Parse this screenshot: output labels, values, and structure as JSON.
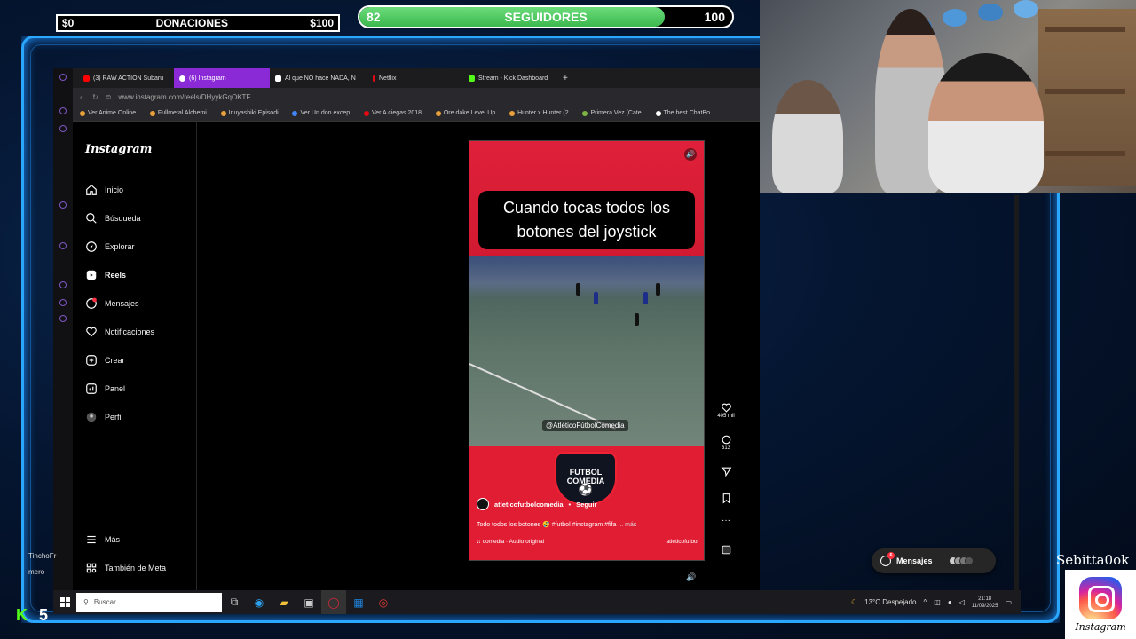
{
  "overlay": {
    "donation_min": "$0",
    "donation_title": "DONACIONES",
    "donation_max": "$100",
    "followers_current": "82",
    "followers_title": "SEGUIDORES",
    "followers_goal": "100",
    "followers_progress": 0.82,
    "streamer_name": "Sebitta0ok",
    "ig_word": "Instagram",
    "chat_user": "TinchoFr",
    "chat_text": "mero",
    "kick_letter": "K",
    "kick_count": "5"
  },
  "browser": {
    "tabs": [
      {
        "label": "(3) RAW ACTION Subaru",
        "color": "#ff0000"
      },
      {
        "label": "(6) Instagram",
        "color": "#ffffff",
        "active": true
      },
      {
        "label": "Al que NO hace NADA, N",
        "color": "#ffffff"
      },
      {
        "label": "Netflix",
        "color": "#e50914"
      },
      {
        "label": "Stream - Kick Dashboard",
        "color": "#53fc18"
      }
    ],
    "url": "www.instagram.com/reels/DHyykGqOKTF",
    "bookmarks": [
      "Ver Anime Online...",
      "Fullmetal Alchemi...",
      "Inuyashiki Episodi...",
      "Ver Un don excep...",
      "Ver A ciegas 2018...",
      "Ore dake Level Up...",
      "Hunter x Hunter (2...",
      "Primera Vez (Cate...",
      "The best ChatBo"
    ]
  },
  "instagram": {
    "logo": "Instagram",
    "nav": [
      {
        "label": "Inicio"
      },
      {
        "label": "Búsqueda"
      },
      {
        "label": "Explorar"
      },
      {
        "label": "Reels"
      },
      {
        "label": "Mensajes",
        "badge": "6"
      },
      {
        "label": "Notificaciones"
      },
      {
        "label": "Crear"
      },
      {
        "label": "Panel"
      },
      {
        "label": "Perfil"
      }
    ],
    "more": "Más",
    "meta": "También de Meta",
    "reel": {
      "caption": "Cuando tocas todos los botones del joystick",
      "watermark": "@AtléticoFútbolComedia",
      "badge_line1": "FUTBOL",
      "badge_line2": "COMEDIA",
      "username": "atleticofutbolcomedia",
      "follow": "Seguir",
      "separator": "•",
      "description": "Todo todos los botones 🤣 #futbol #instagram #fifa",
      "more": "... más",
      "audio": "comedia · Audio original",
      "audio_tag": "atleticofutbol"
    },
    "actions": {
      "likes": "405 mil",
      "comments": "313"
    },
    "messages_pill": "Mensajes",
    "messages_badge": "6"
  },
  "taskbar": {
    "search_placeholder": "Buscar",
    "weather": "13°C Despejado",
    "time": "21:18",
    "date": "11/09/2025"
  },
  "colors": {
    "accent": "#2aa7ff",
    "reel_red": "#e11d34",
    "progress_green": "#3cb84e",
    "tab_active": "#8a2ad6"
  }
}
